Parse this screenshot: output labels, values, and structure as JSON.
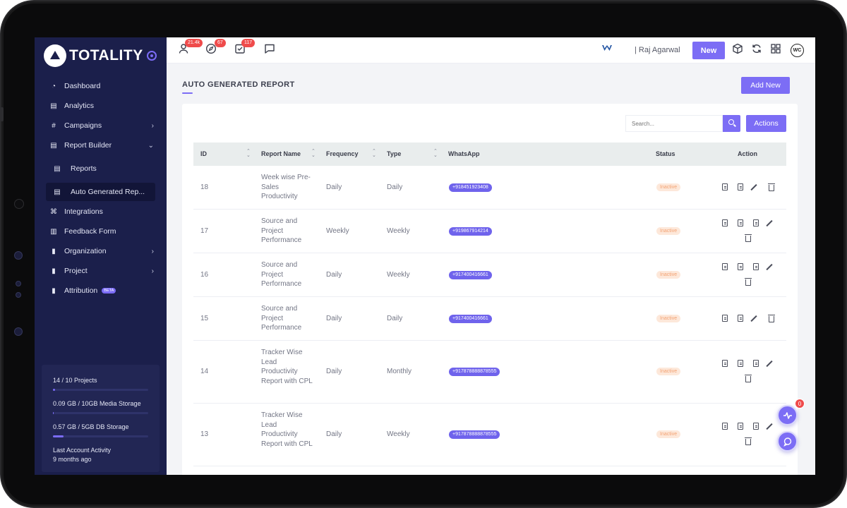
{
  "sidebar": {
    "brand": "TOTALITY",
    "items": [
      {
        "label": "Dashboard"
      },
      {
        "label": "Analytics"
      },
      {
        "label": "Campaigns"
      },
      {
        "label": "Report Builder"
      },
      {
        "label": "Reports"
      },
      {
        "label": "Auto Generated Rep..."
      },
      {
        "label": "Integrations"
      },
      {
        "label": "Feedback Form"
      },
      {
        "label": "Organization"
      },
      {
        "label": "Project"
      },
      {
        "label": "Attribution",
        "badge": "BETA"
      }
    ],
    "usage": {
      "projects": {
        "label": "14 / 10 Projects",
        "fraction": 0.02
      },
      "media": {
        "label": "0.09 GB / 10GB Media Storage",
        "fraction": 0.01
      },
      "db": {
        "label": "0.57 GB / 5GB DB Storage",
        "fraction": 0.11
      },
      "activity_label": "Last Account Activity",
      "activity_value": "9 months ago"
    }
  },
  "topbar": {
    "badges": {
      "users": "21.4k",
      "compass": "67",
      "tasks": "117"
    },
    "user_name": "| Raj Agarwal",
    "new_label": "New",
    "avatar_text": "WC"
  },
  "main": {
    "title": "AUTO GENERATED REPORT",
    "add_new_label": "Add New",
    "search_placeholder": "Search...",
    "actions_label": "Actions",
    "columns": {
      "id": "ID",
      "name": "Report Name",
      "frequency": "Frequency",
      "type": "Type",
      "whatsapp": "WhatsApp",
      "status": "Status",
      "action": "Action"
    },
    "rows": [
      {
        "id": "18",
        "name": "Week wise Pre-Sales Productivity",
        "frequency": "Daily",
        "type": "Daily",
        "whatsapp": "+918451923408",
        "status": "Inactive"
      },
      {
        "id": "17",
        "name": "Source and Project Performance",
        "frequency": "Weekly",
        "type": "Weekly",
        "whatsapp": "+919867914214",
        "status": "Inactive"
      },
      {
        "id": "16",
        "name": "Source and Project Performance",
        "frequency": "Daily",
        "type": "Weekly",
        "whatsapp": "+917400416661",
        "status": "Inactive"
      },
      {
        "id": "15",
        "name": "Source and Project Performance",
        "frequency": "Daily",
        "type": "Daily",
        "whatsapp": "+917400416661",
        "status": "Inactive"
      },
      {
        "id": "14",
        "name": "Tracker Wise Lead Productivity Report with CPL",
        "frequency": "Daily",
        "type": "Monthly",
        "whatsapp": "+917878888878555",
        "status": "Inactive"
      },
      {
        "id": "13",
        "name": "Tracker Wise Lead Productivity Report with CPL",
        "frequency": "Daily",
        "type": "Weekly",
        "whatsapp": "+917878888878555",
        "status": "Inactive"
      }
    ]
  },
  "fab": {
    "badge": "0"
  }
}
